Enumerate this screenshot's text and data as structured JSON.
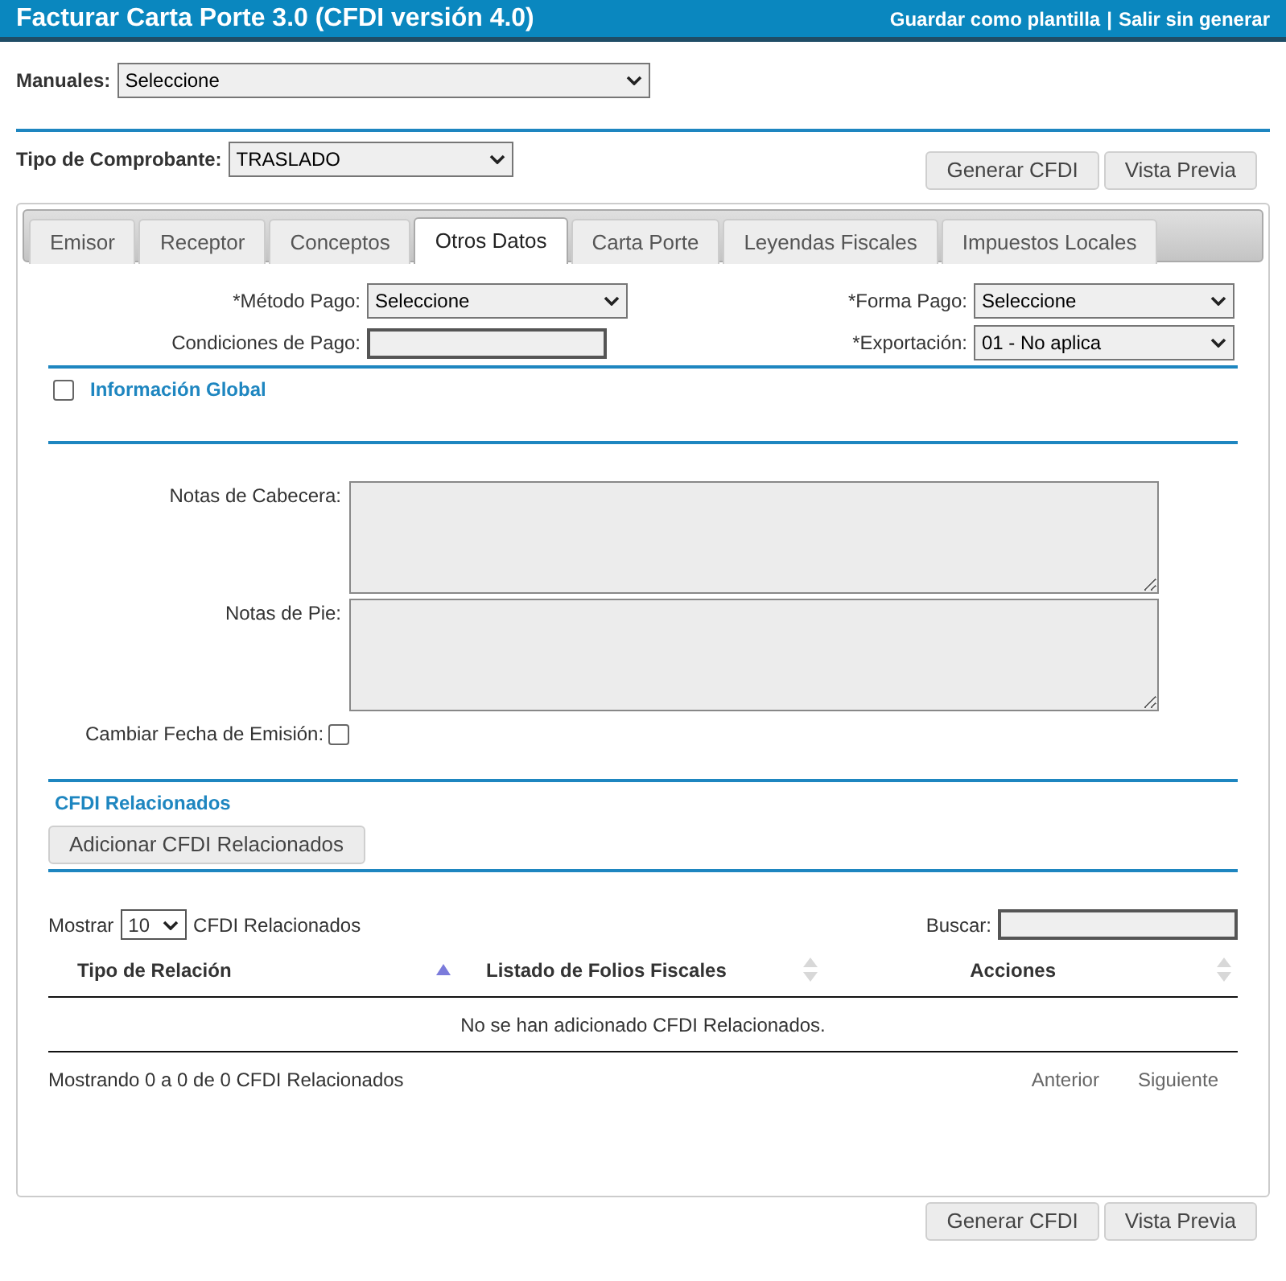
{
  "header": {
    "title": "Facturar Carta Porte 3.0 (CFDI versión 4.0)",
    "links": [
      "Guardar como plantilla",
      "Salir sin generar"
    ],
    "separator": "|"
  },
  "manuales": {
    "label": "Manuales:",
    "value": "Seleccione"
  },
  "tipo": {
    "label": "Tipo de Comprobante:",
    "value": "TRASLADO"
  },
  "top_buttons": [
    "Generar CFDI",
    "Vista Previa"
  ],
  "tabs": [
    {
      "label": "Emisor",
      "selected": false
    },
    {
      "label": "Receptor",
      "selected": false
    },
    {
      "label": "Conceptos",
      "selected": false
    },
    {
      "label": "Otros Datos",
      "selected": true
    },
    {
      "label": "Carta Porte",
      "selected": false
    },
    {
      "label": "Leyendas Fiscales",
      "selected": false
    },
    {
      "label": "Impuestos Locales",
      "selected": false
    }
  ],
  "metodo_pago": {
    "label": "*Método Pago:",
    "value": "Seleccione"
  },
  "forma_pago": {
    "label": "*Forma Pago:",
    "value": "Seleccione"
  },
  "condiciones": {
    "label": "Condiciones de Pago:"
  },
  "exportacion": {
    "label": "*Exportación:",
    "value": "01 - No aplica"
  },
  "informacion_global": {
    "label": "Información Global",
    "checked": false
  },
  "notas_cabecera": {
    "label": "Notas de Cabecera:"
  },
  "notas_pie": {
    "label": "Notas de Pie:"
  },
  "cambiar_fecha": {
    "label": "Cambiar Fecha de Emisión:",
    "checked": false
  },
  "cfdi_relacionados": {
    "title": "CFDI Relacionados",
    "button": "Adicionar CFDI Relacionados"
  },
  "table": {
    "show_label": "Mostrar",
    "page_size": "10",
    "show_suffix": "CFDI Relacionados",
    "search_label": "Buscar:",
    "columns": [
      {
        "label": "Tipo de Relación",
        "sorted": true
      },
      {
        "label": "Listado de Folios Fiscales",
        "sorted": false
      },
      {
        "label": "Acciones",
        "sorted": false
      }
    ],
    "empty": "No se han adicionado CFDI Relacionados.",
    "info": "Mostrando 0 a 0 de 0 CFDI Relacionados",
    "pager": [
      "Anterior",
      "Siguiente"
    ]
  },
  "bottom_buttons": [
    "Generar CFDI",
    "Vista Previa"
  ]
}
